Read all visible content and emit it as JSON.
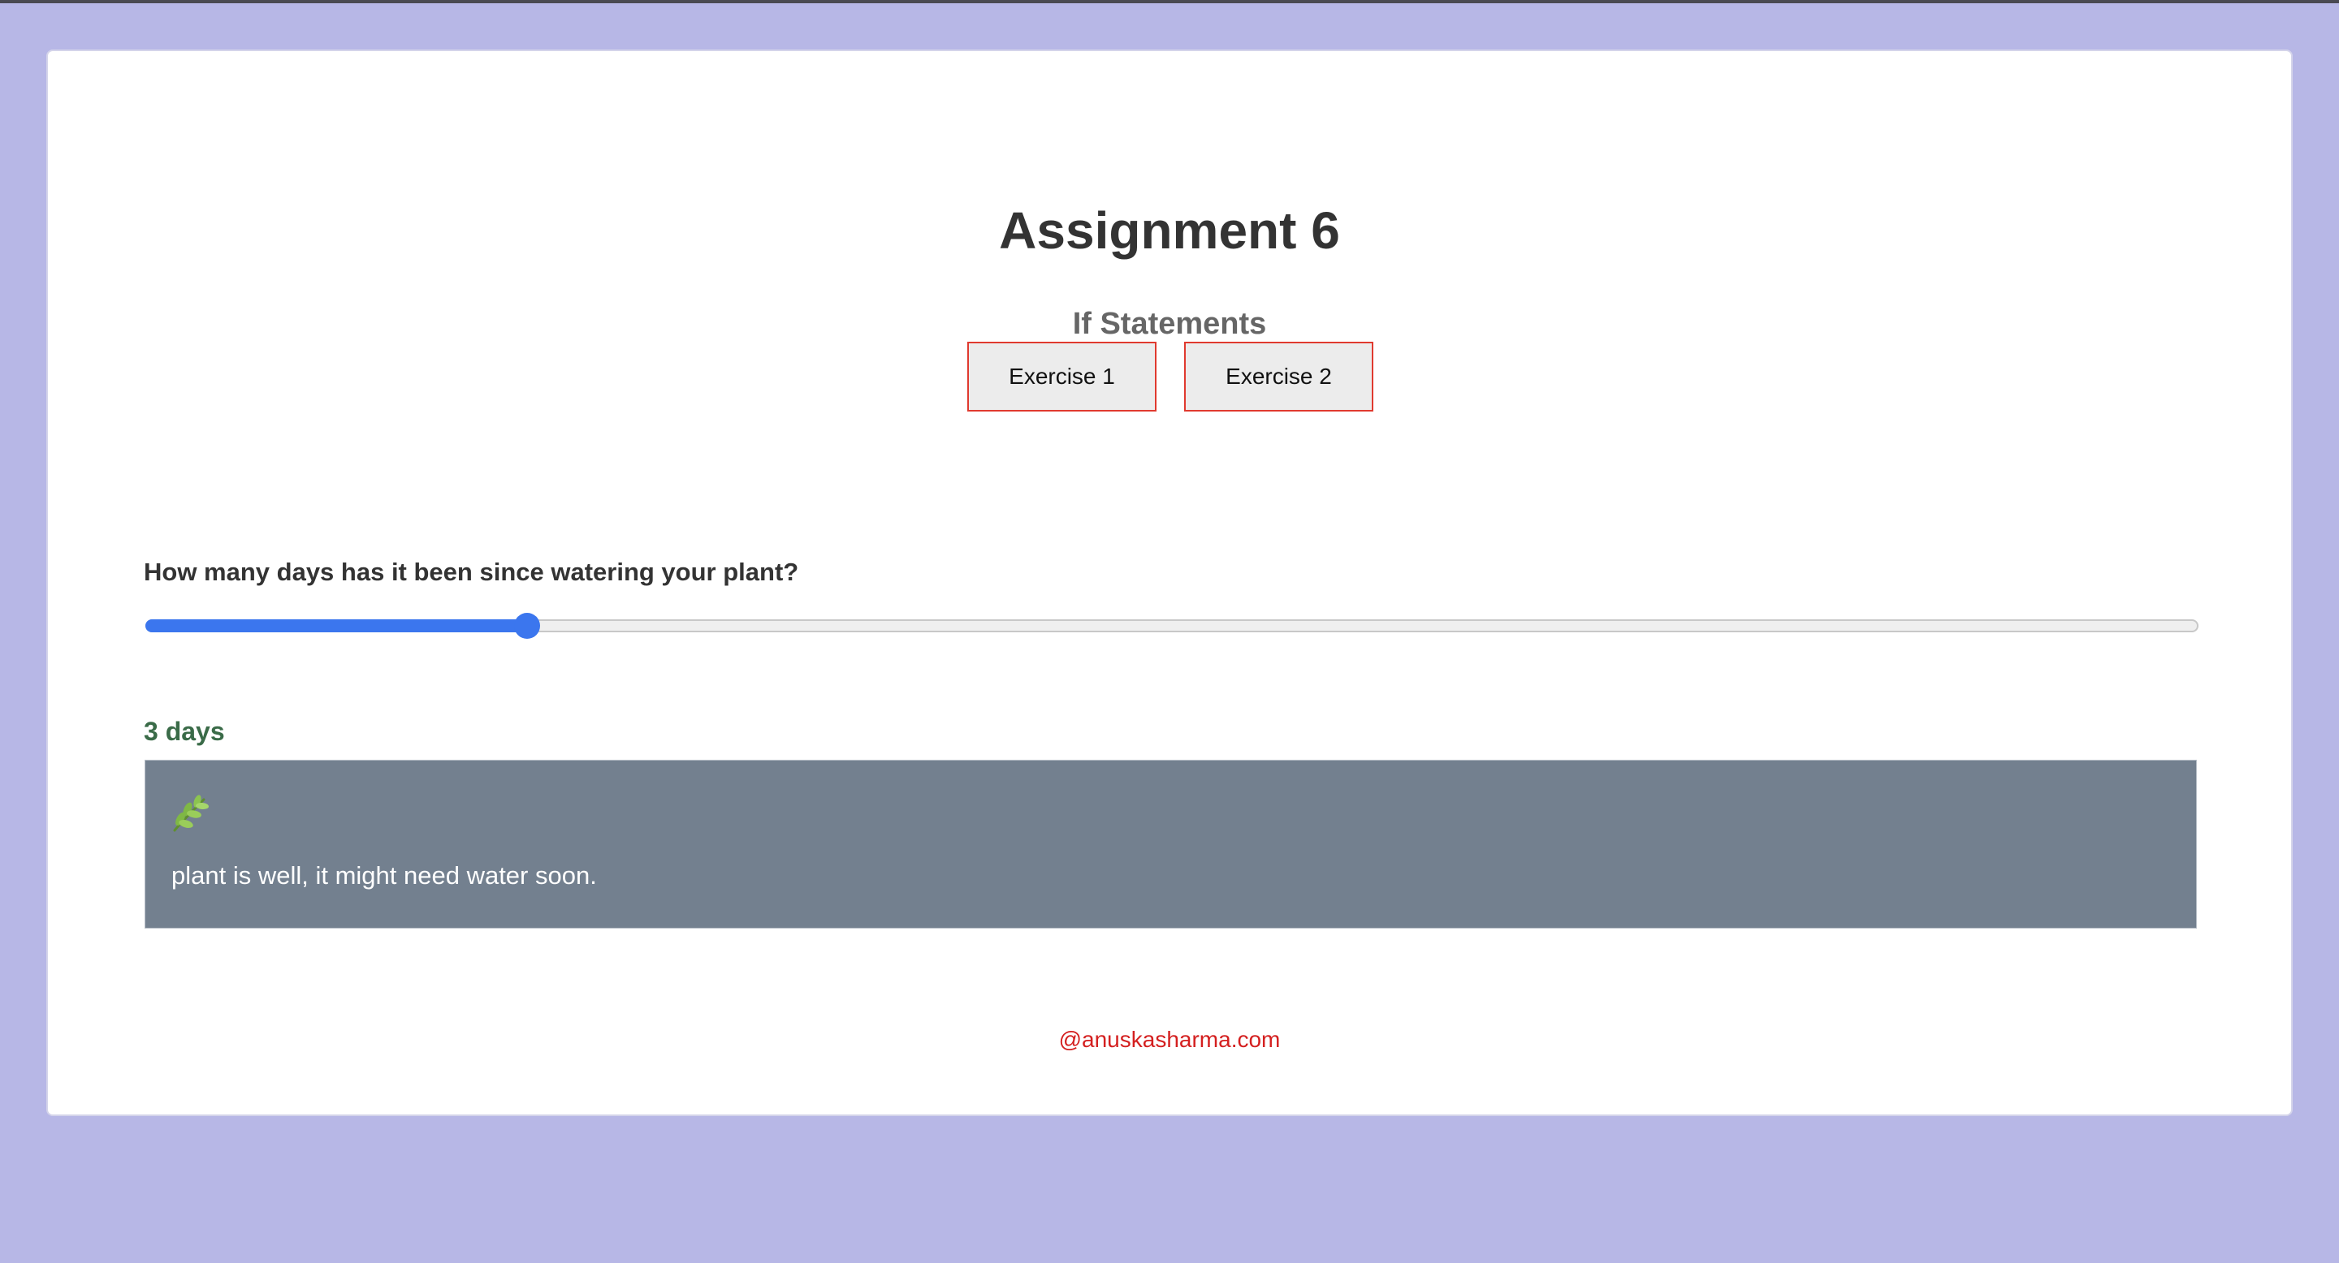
{
  "header": {
    "title": "Assignment 6",
    "subtitle": "If Statements"
  },
  "nav": {
    "buttons": [
      {
        "label": "Exercise 1"
      },
      {
        "label": "Exercise 2"
      }
    ]
  },
  "exercise": {
    "question": "How many days has it been since watering your plant?",
    "slider": {
      "value_fraction": 0.186
    },
    "value_label": "3 days",
    "result": {
      "icon": "herb-icon",
      "text": "plant is well, it might need water soon."
    }
  },
  "footer": {
    "link_text": "@anuskasharma.com"
  },
  "colors": {
    "page_background": "#b7b7e6",
    "button_border": "#e03a2f",
    "slider_accent": "#3b76ee",
    "value_label": "#3a6b48",
    "result_background": "#73808f",
    "footer_link": "#d42020"
  }
}
